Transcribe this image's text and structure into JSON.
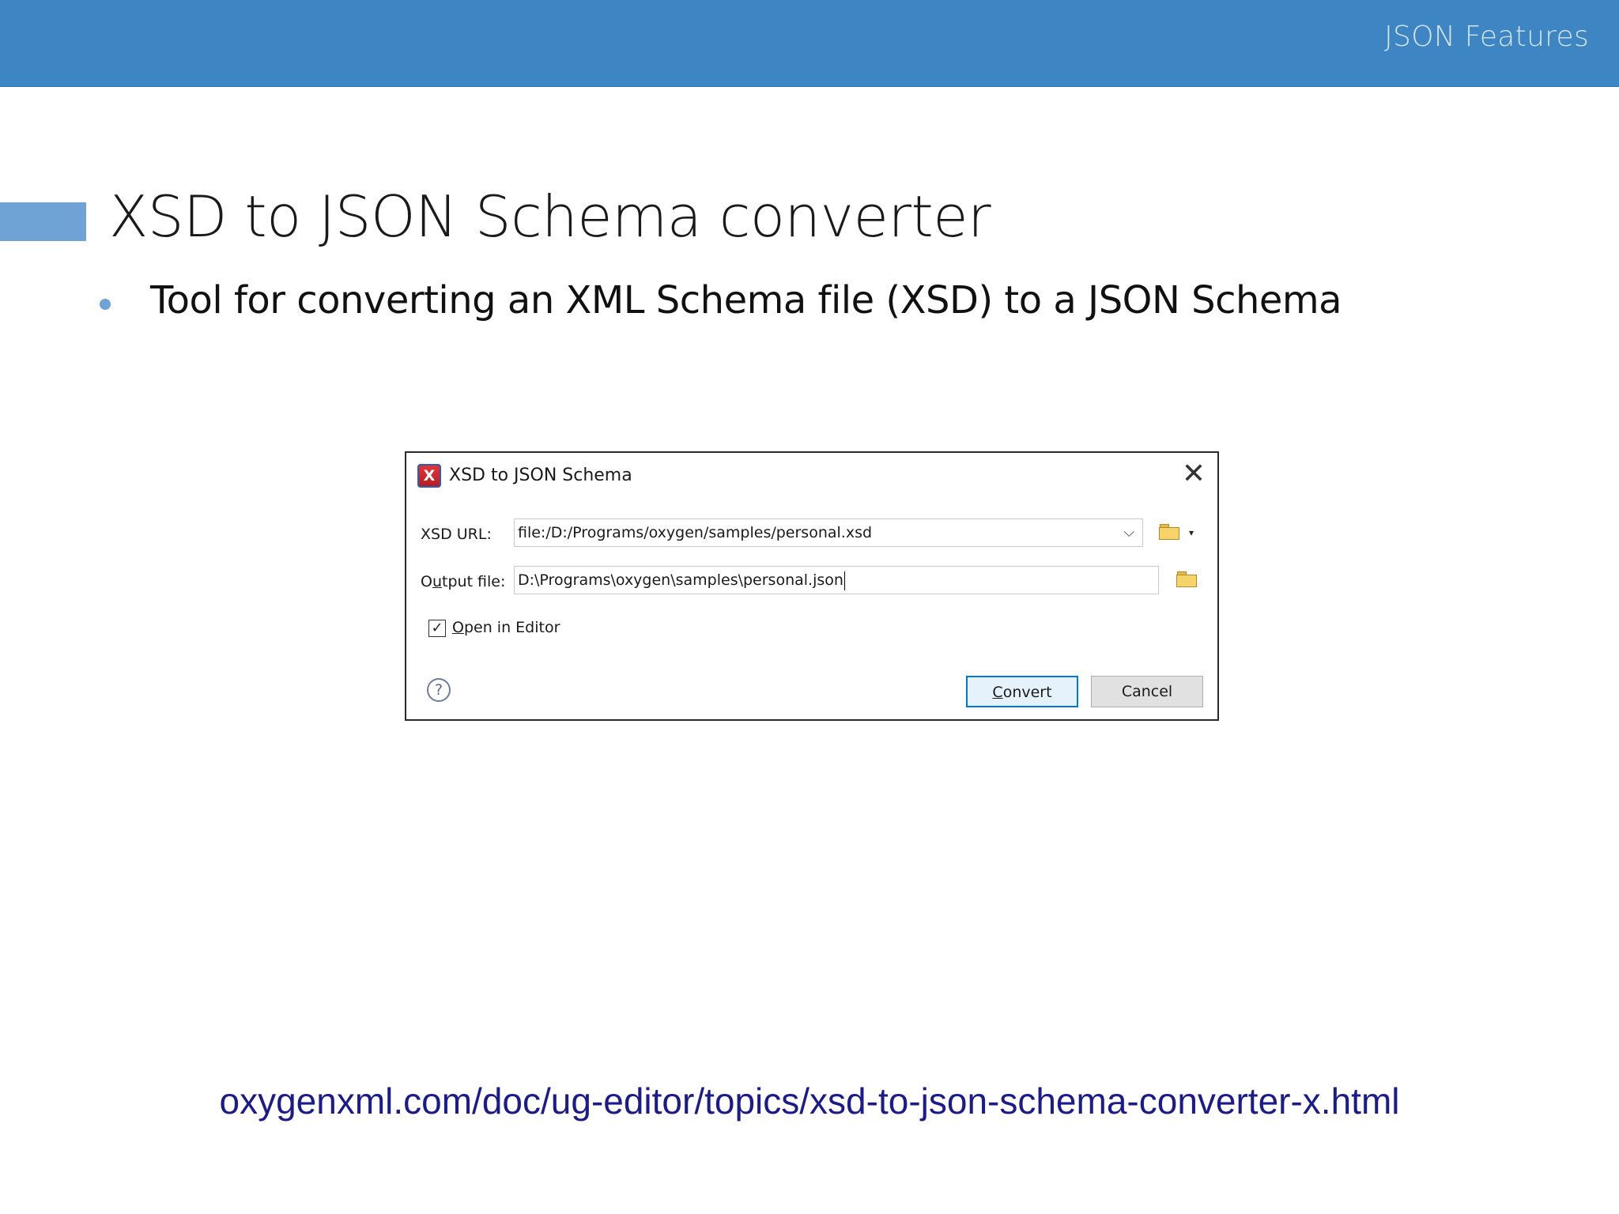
{
  "header": {
    "section_label": "JSON Features"
  },
  "slide": {
    "title": "XSD to JSON Schema converter",
    "bullets": [
      "Tool for converting an XML Schema file (XSD) to a JSON Schema"
    ]
  },
  "dialog": {
    "app_icon_letter": "X",
    "title": "XSD to JSON Schema",
    "close_symbol": "✕",
    "xsd_url": {
      "label": "XSD URL:",
      "value": "file:/D:/Programs/oxygen/samples/personal.xsd",
      "dropdown_symbol": "⌵"
    },
    "output_file": {
      "label_prefix": "O",
      "label_mnemonic": "u",
      "label_suffix": "tput file:",
      "value": "D:\\Programs\\oxygen\\samples\\personal.json"
    },
    "open_in_editor": {
      "checked": true,
      "check_symbol": "✓",
      "label_mnemonic": "O",
      "label_rest": "pen in Editor"
    },
    "help_symbol": "?",
    "convert_button": {
      "mnemonic": "C",
      "rest": "onvert"
    },
    "cancel_button": {
      "label": "Cancel"
    },
    "browse_caret": "▾"
  },
  "footer": {
    "link": "oxygenxml.com/doc/ug-editor/topics/xsd-to-json-schema-converter-x.html"
  },
  "colors": {
    "header_bg": "#3e85c4",
    "accent": "#6fa3d6",
    "link": "#1b1b8c",
    "default_button_border": "#0078d7"
  }
}
